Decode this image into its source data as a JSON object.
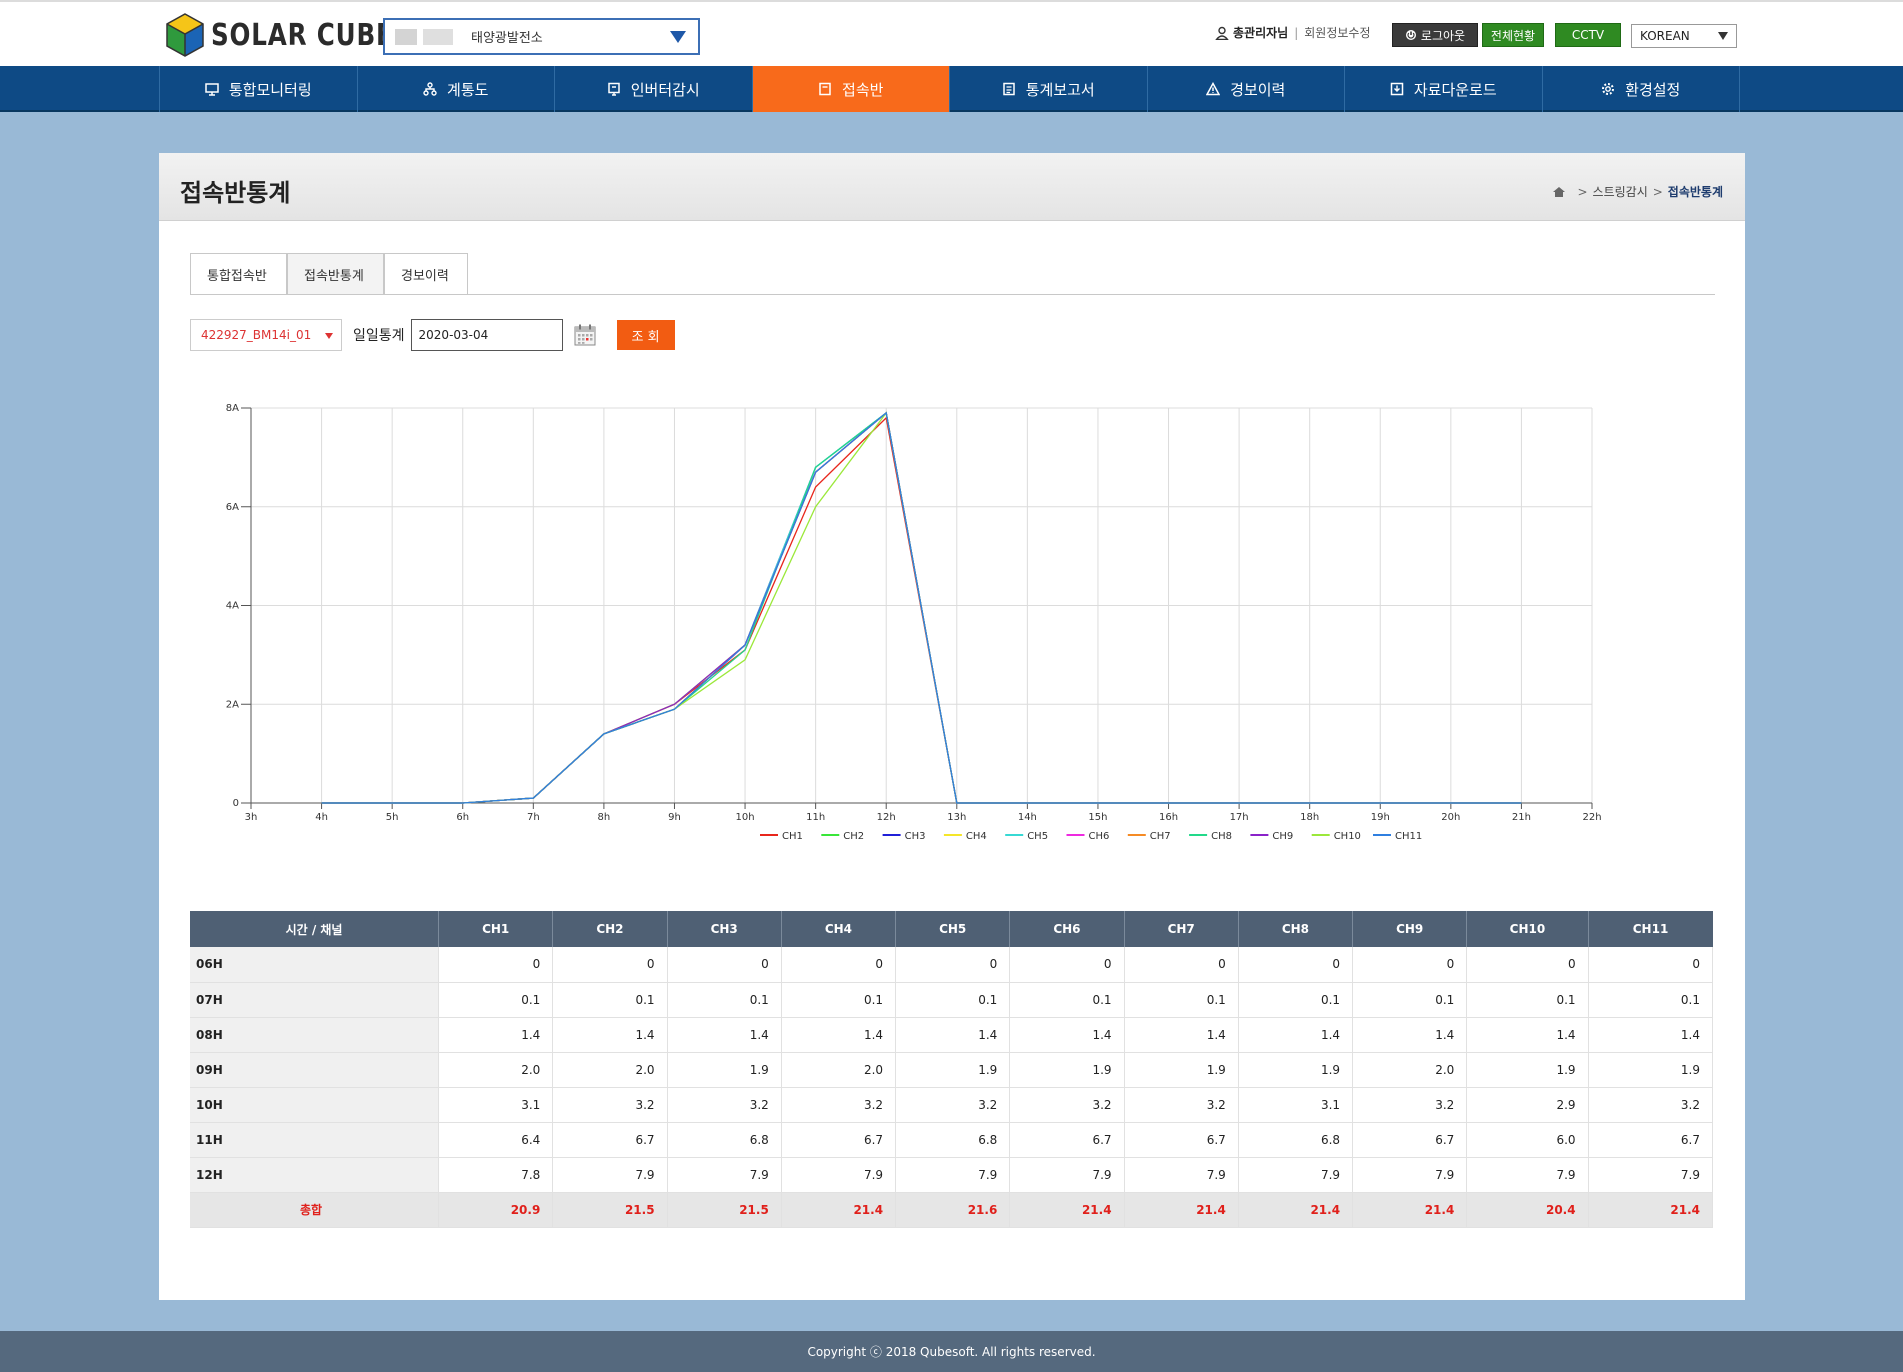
{
  "header": {
    "logo_text": "SOLAR CUBE",
    "plant_name": "태양광발전소",
    "user_name": "총관리자님",
    "edit_profile": "회원정보수정",
    "logout": "로그아웃",
    "overview": "전체현황",
    "cctv": "CCTV",
    "language": "KOREAN"
  },
  "nav": [
    {
      "label": "통합모니터링",
      "icon": "monitor-icon"
    },
    {
      "label": "계통도",
      "icon": "network-icon"
    },
    {
      "label": "인버터감시",
      "icon": "inverter-icon"
    },
    {
      "label": "접속반",
      "icon": "junction-box-icon"
    },
    {
      "label": "통계보고서",
      "icon": "report-icon"
    },
    {
      "label": "경보이력",
      "icon": "alarm-icon"
    },
    {
      "label": "자료다운로드",
      "icon": "download-icon"
    },
    {
      "label": "환경설정",
      "icon": "gear-icon"
    }
  ],
  "page": {
    "title": "접속반통계",
    "breadcrumb": [
      "스트링감시",
      "접속반통계"
    ]
  },
  "tabs": [
    "통합접속반",
    "접속반통계",
    "경보이력"
  ],
  "filter": {
    "device": "422927_BM14i_01",
    "label": "일일통계",
    "date": "2020-03-04",
    "search": "조 회"
  },
  "chart_data": {
    "type": "line",
    "x": [
      "3h",
      "4h",
      "5h",
      "6h",
      "7h",
      "8h",
      "9h",
      "10h",
      "11h",
      "12h",
      "13h",
      "14h",
      "15h",
      "16h",
      "17h",
      "18h",
      "19h",
      "20h",
      "21h",
      "22h"
    ],
    "ylim": [
      0,
      8
    ],
    "yticks": [
      "0",
      "2A",
      "4A",
      "6A",
      "8A"
    ],
    "legend_position": "bottom",
    "grid": true,
    "series": [
      {
        "name": "CH1",
        "color": "#e8261c",
        "values": [
          null,
          0,
          0,
          0,
          0.1,
          1.4,
          2.0,
          3.1,
          6.4,
          7.8,
          0,
          0,
          0,
          0,
          0,
          0,
          0,
          0,
          0,
          null
        ]
      },
      {
        "name": "CH2",
        "color": "#39e639",
        "values": [
          null,
          0,
          0,
          0,
          0.1,
          1.4,
          2.0,
          3.2,
          6.7,
          7.9,
          0,
          0,
          0,
          0,
          0,
          0,
          0,
          0,
          0,
          null
        ]
      },
      {
        "name": "CH3",
        "color": "#2020d8",
        "values": [
          null,
          0,
          0,
          0,
          0.1,
          1.4,
          1.9,
          3.2,
          6.8,
          7.9,
          0,
          0,
          0,
          0,
          0,
          0,
          0,
          0,
          0,
          null
        ]
      },
      {
        "name": "CH4",
        "color": "#f5e629",
        "values": [
          null,
          0,
          0,
          0,
          0.1,
          1.4,
          2.0,
          3.2,
          6.7,
          7.9,
          0,
          0,
          0,
          0,
          0,
          0,
          0,
          0,
          0,
          null
        ]
      },
      {
        "name": "CH5",
        "color": "#37d9d4",
        "values": [
          null,
          0,
          0,
          0,
          0.1,
          1.4,
          1.9,
          3.2,
          6.8,
          7.9,
          0,
          0,
          0,
          0,
          0,
          0,
          0,
          0,
          0,
          null
        ]
      },
      {
        "name": "CH6",
        "color": "#ee2ae0",
        "values": [
          null,
          0,
          0,
          0,
          0.1,
          1.4,
          1.9,
          3.2,
          6.7,
          7.9,
          0,
          0,
          0,
          0,
          0,
          0,
          0,
          0,
          0,
          null
        ]
      },
      {
        "name": "CH7",
        "color": "#f58b25",
        "values": [
          null,
          0,
          0,
          0,
          0.1,
          1.4,
          1.9,
          3.2,
          6.7,
          7.9,
          0,
          0,
          0,
          0,
          0,
          0,
          0,
          0,
          0,
          null
        ]
      },
      {
        "name": "CH8",
        "color": "#22d98a",
        "values": [
          null,
          0,
          0,
          0,
          0.1,
          1.4,
          1.9,
          3.1,
          6.8,
          7.9,
          0,
          0,
          0,
          0,
          0,
          0,
          0,
          0,
          0,
          null
        ]
      },
      {
        "name": "CH9",
        "color": "#8a22c9",
        "values": [
          null,
          0,
          0,
          0,
          0.1,
          1.4,
          2.0,
          3.2,
          6.7,
          7.9,
          0,
          0,
          0,
          0,
          0,
          0,
          0,
          0,
          0,
          null
        ]
      },
      {
        "name": "CH10",
        "color": "#9be83a",
        "values": [
          null,
          0,
          0,
          0,
          0.1,
          1.4,
          1.9,
          2.9,
          6.0,
          7.9,
          0,
          0,
          0,
          0,
          0,
          0,
          0,
          0,
          0,
          null
        ]
      },
      {
        "name": "CH11",
        "color": "#2f7fe0",
        "values": [
          null,
          0,
          0,
          0,
          0.1,
          1.4,
          1.9,
          3.2,
          6.7,
          7.9,
          0,
          0,
          0,
          0,
          0,
          0,
          0,
          0,
          0,
          null
        ]
      }
    ]
  },
  "table": {
    "header": [
      "시간 / 채널",
      "CH1",
      "CH2",
      "CH3",
      "CH4",
      "CH5",
      "CH6",
      "CH7",
      "CH8",
      "CH9",
      "CH10",
      "CH11"
    ],
    "rows": [
      [
        "06H",
        "0",
        "0",
        "0",
        "0",
        "0",
        "0",
        "0",
        "0",
        "0",
        "0",
        "0"
      ],
      [
        "07H",
        "0.1",
        "0.1",
        "0.1",
        "0.1",
        "0.1",
        "0.1",
        "0.1",
        "0.1",
        "0.1",
        "0.1",
        "0.1"
      ],
      [
        "08H",
        "1.4",
        "1.4",
        "1.4",
        "1.4",
        "1.4",
        "1.4",
        "1.4",
        "1.4",
        "1.4",
        "1.4",
        "1.4"
      ],
      [
        "09H",
        "2.0",
        "2.0",
        "1.9",
        "2.0",
        "1.9",
        "1.9",
        "1.9",
        "1.9",
        "2.0",
        "1.9",
        "1.9"
      ],
      [
        "10H",
        "3.1",
        "3.2",
        "3.2",
        "3.2",
        "3.2",
        "3.2",
        "3.2",
        "3.1",
        "3.2",
        "2.9",
        "3.2"
      ],
      [
        "11H",
        "6.4",
        "6.7",
        "6.8",
        "6.7",
        "6.8",
        "6.7",
        "6.7",
        "6.8",
        "6.7",
        "6.0",
        "6.7"
      ],
      [
        "12H",
        "7.8",
        "7.9",
        "7.9",
        "7.9",
        "7.9",
        "7.9",
        "7.9",
        "7.9",
        "7.9",
        "7.9",
        "7.9"
      ]
    ],
    "total": [
      "총합",
      "20.9",
      "21.5",
      "21.5",
      "21.4",
      "21.6",
      "21.4",
      "21.4",
      "21.4",
      "21.4",
      "20.4",
      "21.4"
    ]
  },
  "footer": "Copyright ⓒ 2018 Qubesoft. All rights reserved."
}
